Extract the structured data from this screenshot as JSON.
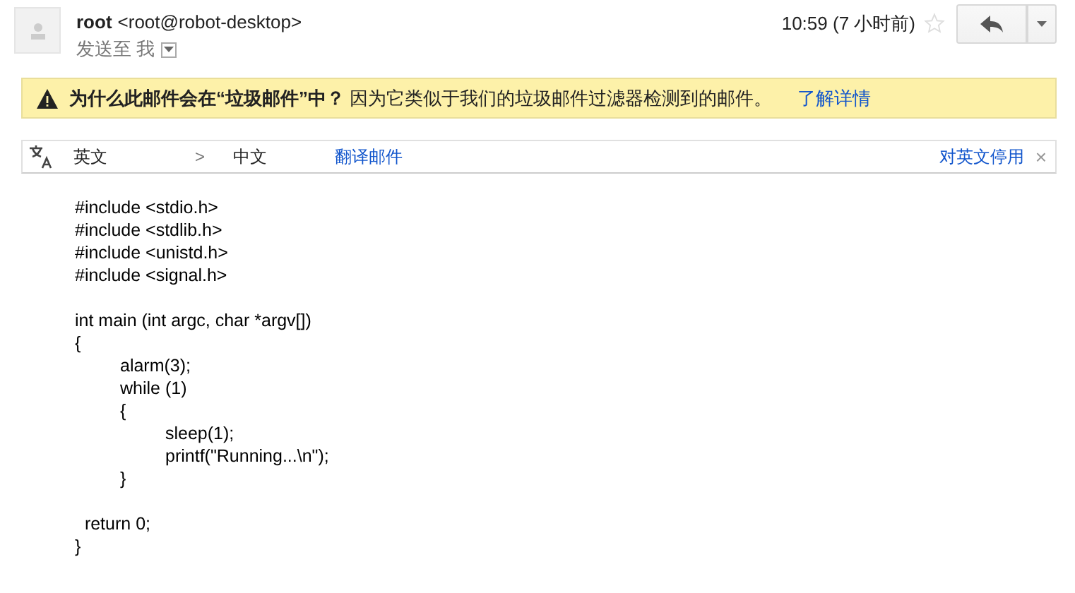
{
  "sender": {
    "name": "root",
    "address": "<root@robot-desktop>",
    "to_label": "发送至 我"
  },
  "time": "10:59 (7 小时前)",
  "starred": false,
  "spam_notice": {
    "title": "为什么此邮件会在“垃圾邮件”中？",
    "text": "因为它类似于我们的垃圾邮件过滤器检测到的邮件。",
    "link": "了解详情"
  },
  "translate_bar": {
    "from": "英文",
    "arrow": ">",
    "to": "中文",
    "action": "翻译邮件",
    "disable": "对英文停用",
    "close": "×"
  },
  "body_blocks": [
    [
      "#include <stdio.h>",
      "#include <stdlib.h>",
      "#include <unistd.h>",
      "#include <signal.h>"
    ],
    [
      "int main (int argc, char *argv[])",
      "{",
      "\talarm(3);",
      "\twhile (1)",
      "\t{",
      "\t\tsleep(1);",
      "\t\tprintf(\"Running...\\n\");",
      "\t}"
    ],
    [
      "  return 0;",
      "}"
    ]
  ]
}
